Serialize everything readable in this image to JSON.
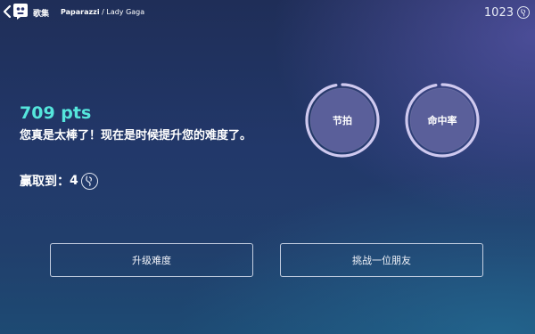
{
  "header": {
    "app_label": "歌集",
    "song_title": "Paparazzi",
    "separator": " / ",
    "artist": "Lady Gaga",
    "coins": "1023",
    "icons": {
      "back": "chevron-left-icon",
      "logo": "app-logo-icon",
      "coin": "coin-icon"
    }
  },
  "result": {
    "score": "709 pts",
    "message": "您真是太棒了！现在是时候提升您的难度了。",
    "earned_label": "赢取到：",
    "earned_value": "4"
  },
  "stats": [
    {
      "label": "节拍",
      "progress": 0.97
    },
    {
      "label": "命中率",
      "progress": 0.97
    }
  ],
  "actions": {
    "upgrade_label": "升级难度",
    "challenge_label": "挑战一位朋友"
  },
  "colors": {
    "score": "#55e6dc",
    "ring": "#cfc9ef",
    "circle_fill": "#5a5f9a"
  }
}
